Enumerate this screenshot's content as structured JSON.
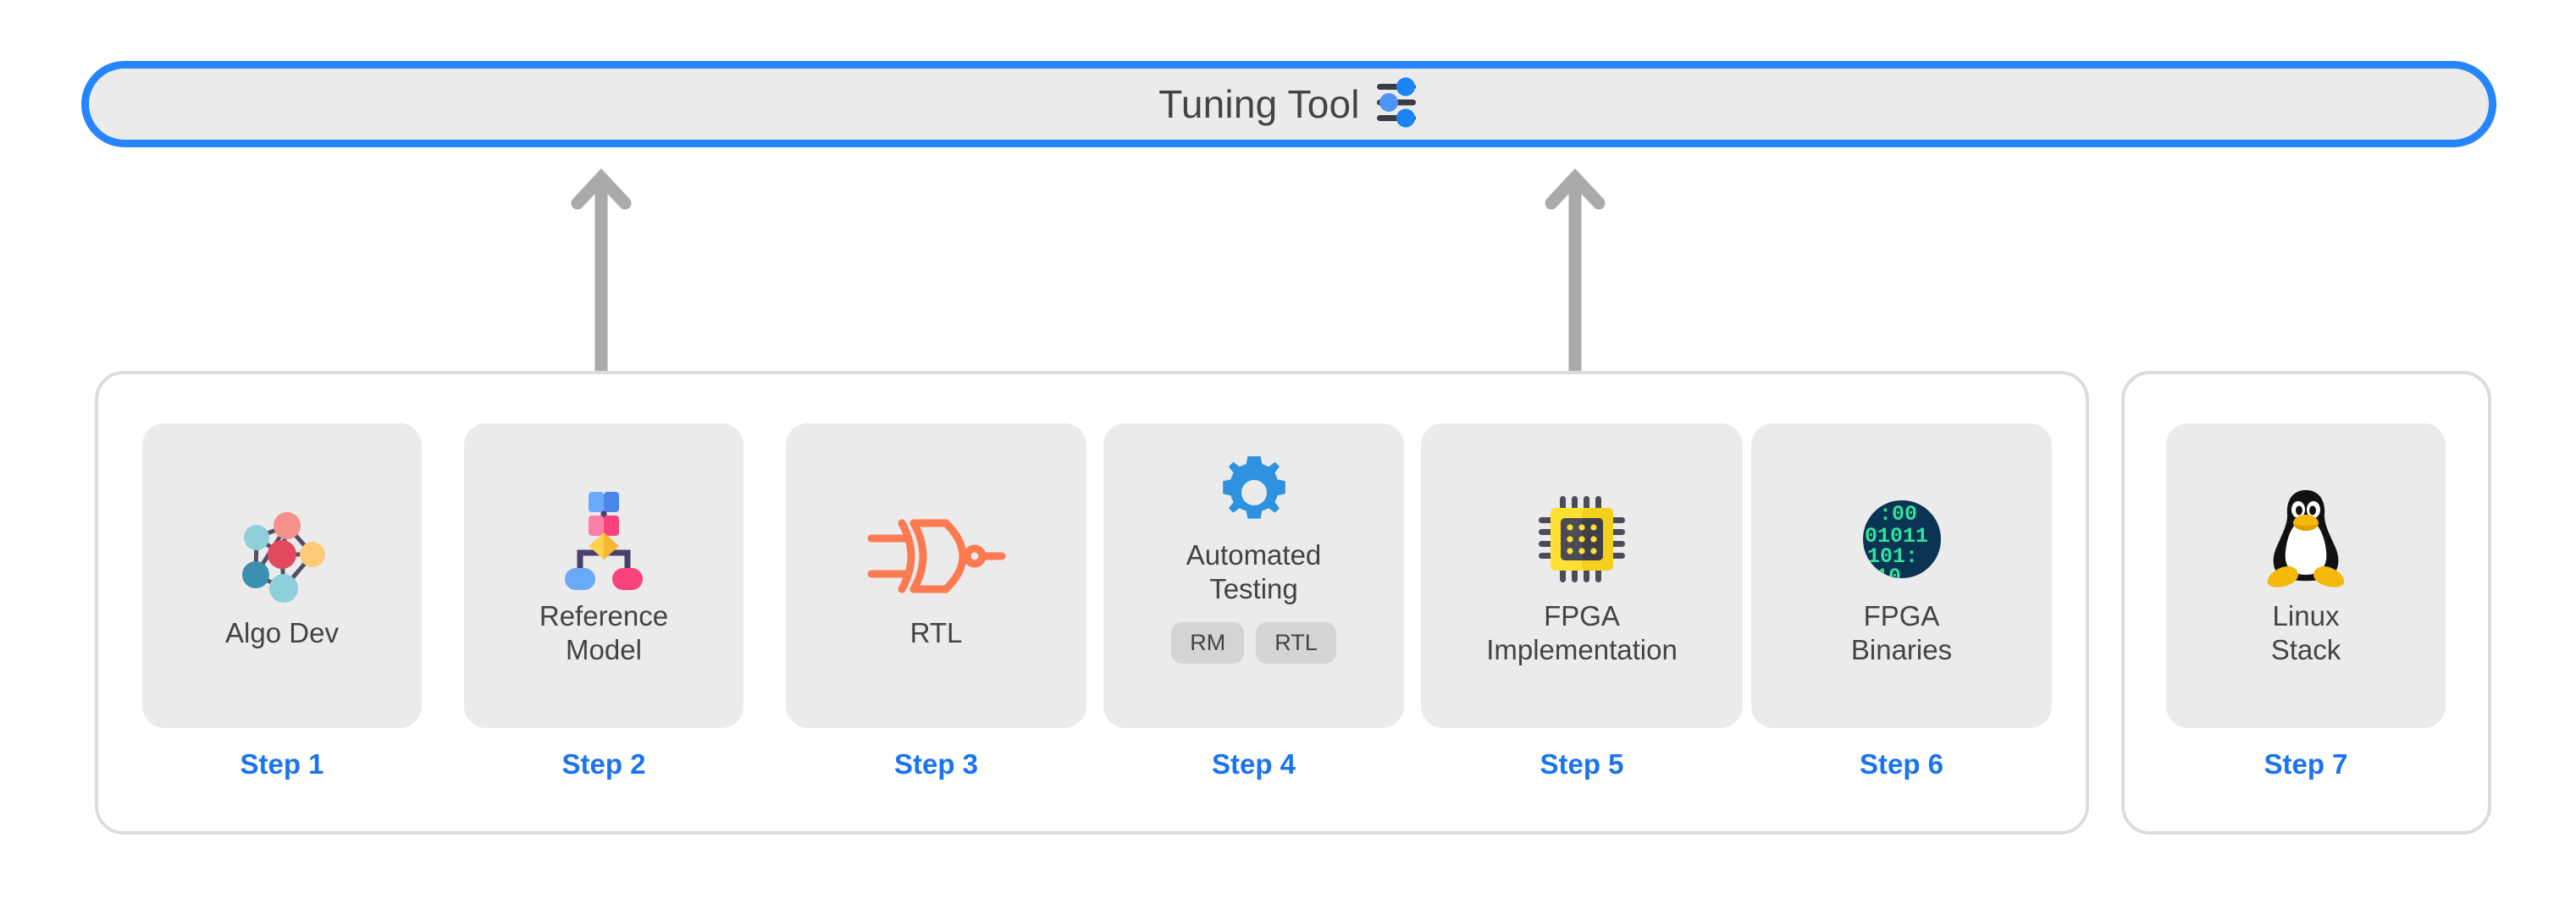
{
  "banner": {
    "title": "Tuning Tool",
    "icon": "sliders-icon",
    "border_color": "#2684fc",
    "fill_color": "#ebebeb"
  },
  "connectors": [
    {
      "name": "arrow-tuning-to-step2",
      "icon": "double-arrow-vertical-icon",
      "color": "#aaaaaa"
    },
    {
      "name": "arrow-tuning-to-step5",
      "icon": "double-arrow-vertical-icon",
      "color": "#aaaaaa"
    }
  ],
  "theme": {
    "step_label_color": "#1a73f0",
    "card_fill": "#ebebeb",
    "badge_fill": "#d4d4d4",
    "text_color": "#434343",
    "group_border": "#dcdcdc"
  },
  "groups": [
    {
      "name": "main-flow-group",
      "steps": [
        1,
        2,
        3,
        4,
        5,
        6
      ]
    },
    {
      "name": "aux-group",
      "steps": [
        7
      ]
    }
  ],
  "steps": [
    {
      "id": "step-1",
      "label": "Algo Dev",
      "step_label": "Step 1",
      "icon": "neural-network-icon",
      "badges": []
    },
    {
      "id": "step-2",
      "label": "Reference\nModel",
      "step_label": "Step 2",
      "icon": "flowchart-icon",
      "badges": []
    },
    {
      "id": "step-3",
      "label": "RTL",
      "step_label": "Step 3",
      "icon": "logic-gate-icon",
      "badges": []
    },
    {
      "id": "step-4",
      "label": "Automated\nTesting",
      "step_label": "Step 4",
      "icon": "gear-icon",
      "badges": [
        "RM",
        "RTL"
      ]
    },
    {
      "id": "step-5",
      "label": "FPGA\nImplementation",
      "step_label": "Step 5",
      "icon": "microchip-icon",
      "badges": []
    },
    {
      "id": "step-6",
      "label": "FPGA\nBinaries",
      "step_label": "Step 6",
      "icon": "binary-circle-icon",
      "badges": []
    },
    {
      "id": "step-7",
      "label": "Linux\nStack",
      "step_label": "Step 7",
      "icon": "linux-penguin-icon",
      "badges": []
    }
  ]
}
